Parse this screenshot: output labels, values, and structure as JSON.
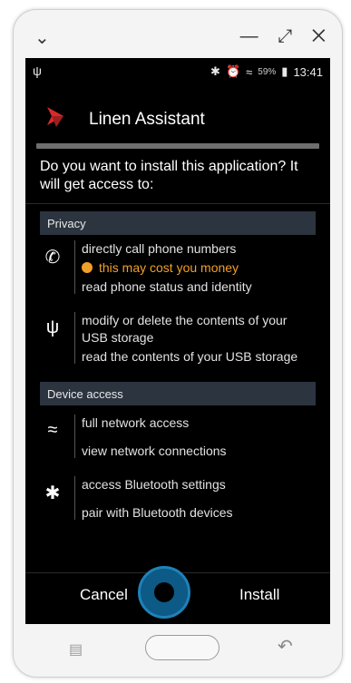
{
  "window": {
    "minimize": "—",
    "restore": "⤢",
    "close": "✕"
  },
  "statusbar": {
    "time": "13:41",
    "battery": "59%"
  },
  "app": {
    "name": "Linen Assistant"
  },
  "question": "Do you want to install this application? It will get access to:",
  "sections": {
    "privacy": "Privacy",
    "device": "Device access"
  },
  "perms": {
    "phone": {
      "line1": "directly call phone numbers",
      "warn": "this may cost you money",
      "line2": "read phone status and identity"
    },
    "usb": {
      "line1": "modify or delete the contents of your USB storage",
      "line2": "read the contents of your USB storage"
    },
    "network": {
      "line1": "full network access",
      "line2": "view network connections"
    },
    "bluetooth": {
      "line1": "access Bluetooth settings",
      "line2": "pair with Bluetooth devices"
    }
  },
  "buttons": {
    "cancel": "Cancel",
    "install": "Install"
  },
  "colors": {
    "accent": "#f0a028",
    "section_bg": "#2c3440",
    "logo_red": "#d62a2a"
  }
}
